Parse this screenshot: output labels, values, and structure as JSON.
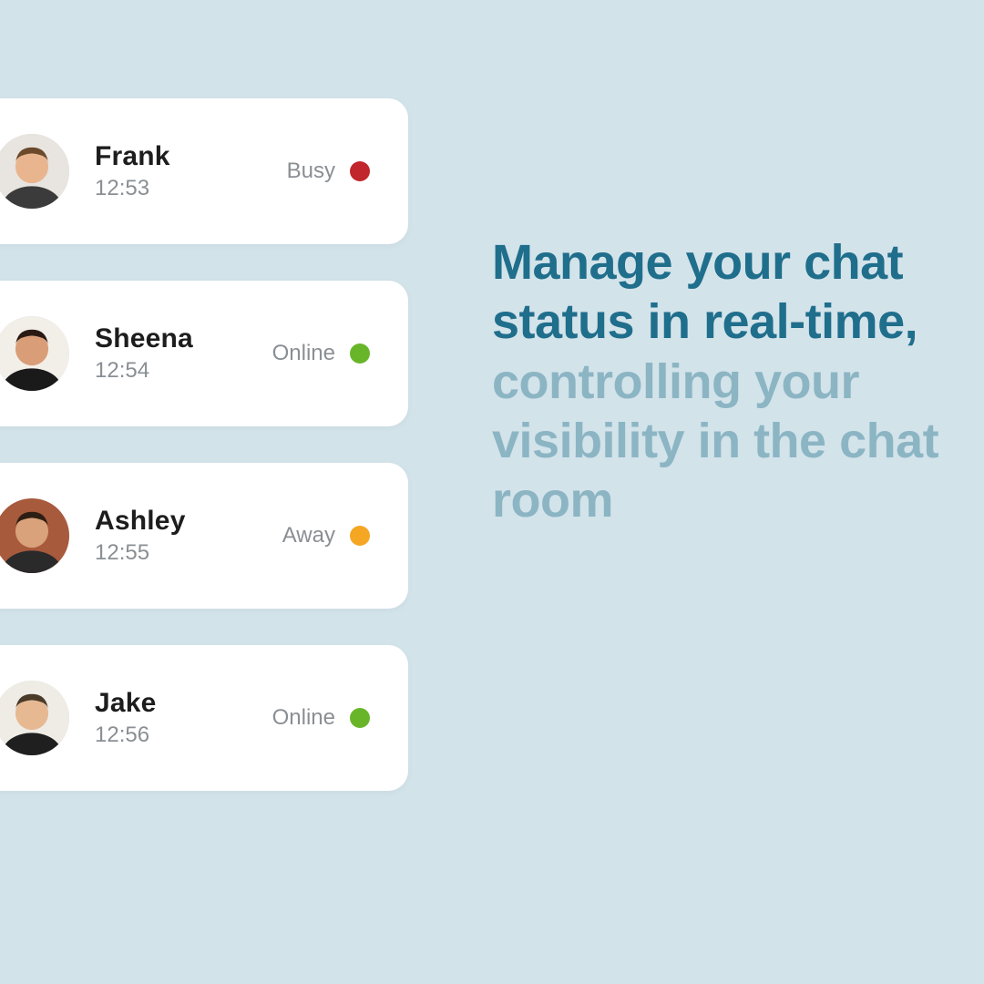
{
  "headline": {
    "primary": "Manage your chat status in real-time,",
    "secondary": " controlling your visibility in the chat room"
  },
  "status_colors": {
    "busy": "#c0262c",
    "online": "#69b52a",
    "away": "#f5a623"
  },
  "users": [
    {
      "name": "Frank",
      "time": "12:53",
      "status_label": "Busy",
      "status_key": "busy",
      "avatar": {
        "bg": "#e8e4df",
        "skin": "#e9b58f",
        "hair": "#6b4a2b",
        "shirt": "#3b3b3b"
      }
    },
    {
      "name": "Sheena",
      "time": "12:54",
      "status_label": "Online",
      "status_key": "online",
      "avatar": {
        "bg": "#f2efe9",
        "skin": "#d99e78",
        "hair": "#2b1a14",
        "shirt": "#1a1a1a"
      }
    },
    {
      "name": "Ashley",
      "time": "12:55",
      "status_label": "Away",
      "status_key": "away",
      "avatar": {
        "bg": "#a85a3c",
        "skin": "#d9a27a",
        "hair": "#2d1e14",
        "shirt": "#2a2a2a"
      }
    },
    {
      "name": "Jake",
      "time": "12:56",
      "status_label": "Online",
      "status_key": "online",
      "avatar": {
        "bg": "#efece6",
        "skin": "#e6b993",
        "hair": "#4a3a2a",
        "shirt": "#1f1f1f"
      }
    }
  ]
}
